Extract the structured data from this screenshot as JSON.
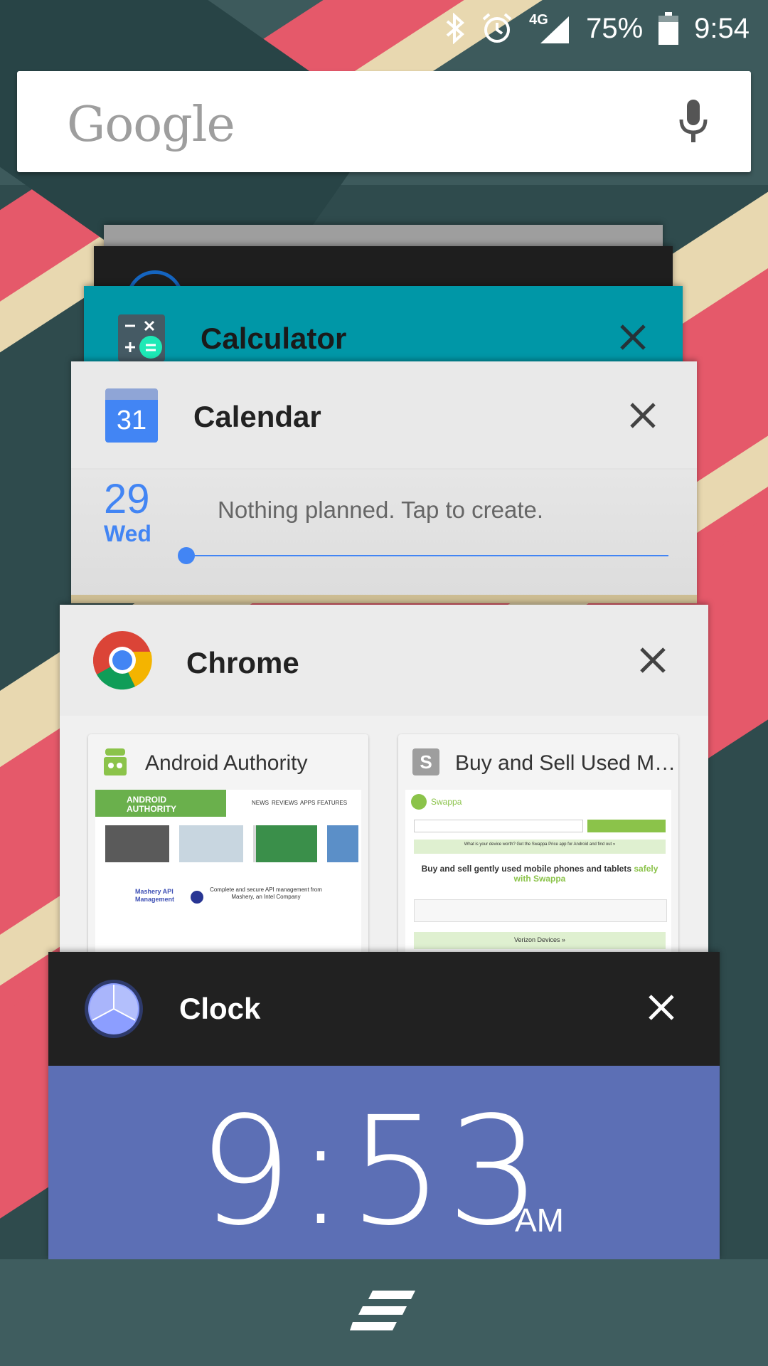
{
  "status_bar": {
    "bluetooth_icon": "bluetooth-icon",
    "alarm_icon": "alarm-icon",
    "network_type": "4G",
    "battery_percent": "75%",
    "time": "9:54"
  },
  "search_bar": {
    "logo_text": "Google",
    "mic_icon": "microphone-icon"
  },
  "cards": {
    "calculator": {
      "title": "Calculator",
      "header_color": "#0097a7"
    },
    "calendar": {
      "title": "Calendar",
      "icon_date": "31",
      "day_number": "29",
      "day_name": "Wed",
      "empty_message": "Nothing planned. Tap to create."
    },
    "chrome": {
      "title": "Chrome",
      "tabs": [
        {
          "title": "Android Authority",
          "favicon": "android-authority-icon"
        },
        {
          "title": "Buy and Sell Used M…",
          "favicon_letter": "S"
        }
      ],
      "tab1_preview": {
        "site_name": "ANDROID AUTHORITY",
        "nav": [
          "NEWS",
          "REVIEWS",
          "APPS",
          "FEATURES"
        ],
        "ad_title": "Mashery API Management",
        "ad_text": "Complete and secure API management from Mashery, an Intel Company"
      },
      "tab2_preview": {
        "site_name": "Swappa",
        "promo": "What is your device worth? Get the Swappa Price app for Android and find out »",
        "headline": "Buy and sell gently used mobile phones and tablets",
        "headline_accent": "safely with Swappa",
        "carrier": "Verizon Devices »"
      }
    },
    "clock": {
      "title": "Clock",
      "time": "9:53",
      "ampm": "AM",
      "body_color": "#5c6fb5"
    }
  },
  "nav_bar": {
    "recents_icon": "recents-icon"
  }
}
